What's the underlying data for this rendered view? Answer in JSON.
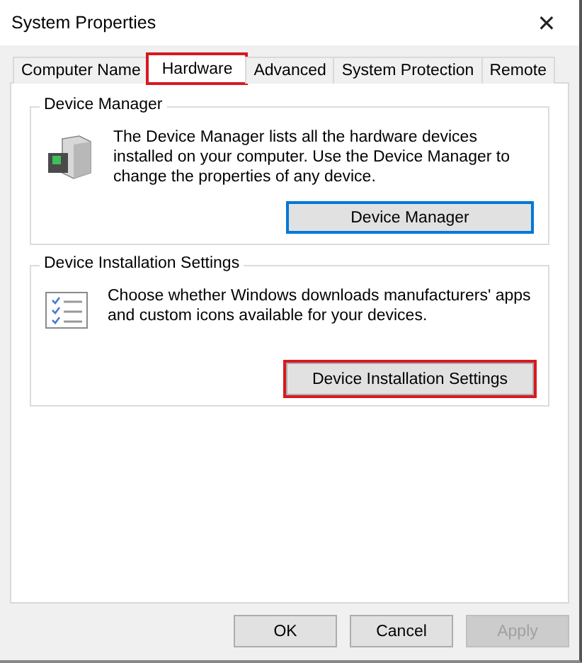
{
  "window": {
    "title": "System Properties",
    "close": "✕"
  },
  "tabs": [
    {
      "label": "Computer Name",
      "selected": false,
      "highlighted": false
    },
    {
      "label": "Hardware",
      "selected": true,
      "highlighted": true
    },
    {
      "label": "Advanced",
      "selected": false,
      "highlighted": false
    },
    {
      "label": "System Protection",
      "selected": false,
      "highlighted": false
    },
    {
      "label": "Remote",
      "selected": false,
      "highlighted": false
    }
  ],
  "groups": [
    {
      "title": "Device Manager",
      "kind": "device",
      "text": "The Device Manager lists all the hardware devices installed on your computer. Use the Device Manager to change the properties of any device.",
      "button": {
        "label": "Device Manager",
        "focused": true,
        "highlighted": false
      }
    },
    {
      "title": "Device Installation Settings",
      "kind": "checklist",
      "text": "Choose whether Windows downloads manufacturers' apps and custom icons available for your devices.",
      "button": {
        "label": "Device Installation Settings",
        "focused": false,
        "highlighted": true
      }
    }
  ],
  "buttons": [
    {
      "label": "OK",
      "disabled": false
    },
    {
      "label": "Cancel",
      "disabled": false
    },
    {
      "label": "Apply",
      "disabled": true
    }
  ]
}
